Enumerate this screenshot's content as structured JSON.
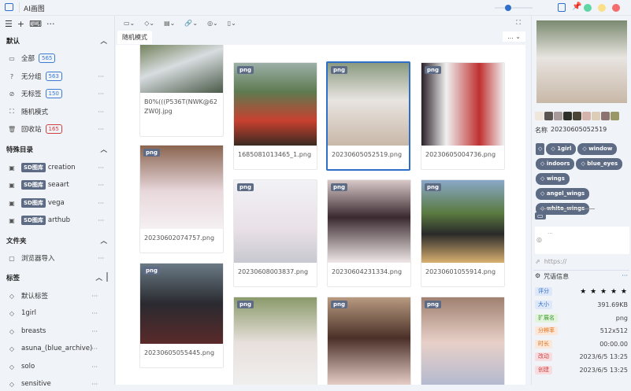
{
  "app": {
    "title": "AI画图",
    "zoom_slider": 0.1,
    "colors": {
      "accent": "#2d6fc9",
      "green": "#5fd6a4",
      "yellow": "#fbe08a",
      "red": "#f46c6c"
    }
  },
  "sidebar": {
    "sections": [
      {
        "title": "默认",
        "items": [
          {
            "icon": "drive-icon",
            "label": "全部",
            "count": "565"
          },
          {
            "icon": "question-icon",
            "label": "无分组",
            "count": "563"
          },
          {
            "icon": "tag-off-icon",
            "label": "无标签",
            "count": "150"
          },
          {
            "icon": "shuffle-icon",
            "label": "随机模式"
          },
          {
            "icon": "trash-icon",
            "label": "回收站",
            "count": "165"
          }
        ]
      },
      {
        "title": "特殊目录",
        "badge": "SD图库",
        "items": [
          {
            "label": "creation"
          },
          {
            "label": "seaart"
          },
          {
            "label": "vega"
          },
          {
            "label": "arthub"
          }
        ]
      },
      {
        "title": "文件夹",
        "items": [
          {
            "label": "浏览器导入"
          }
        ]
      },
      {
        "title": "标签",
        "items": [
          {
            "label": "默认标签"
          },
          {
            "label": "1girl"
          },
          {
            "label": "breasts"
          },
          {
            "label": "asuna_(blue_archive)"
          },
          {
            "label": "solo"
          },
          {
            "label": "sensitive"
          }
        ]
      }
    ],
    "more": "···"
  },
  "main": {
    "tab": "随机模式",
    "more": "... ⌄",
    "cards": [
      {
        "caption": "B0%(((P536T(NWK@62ZW0J.jpg",
        "type": ""
      },
      {
        "caption": "20230602074757.png",
        "type": "png"
      },
      {
        "caption": "20230605055445.png",
        "type": "png"
      },
      {
        "caption": "1685081013465_1.png",
        "type": "png"
      },
      {
        "caption": "20230608003837.png",
        "type": "png"
      },
      {
        "caption": "",
        "type": "png"
      },
      {
        "caption": "20230605052519.png",
        "type": "png"
      },
      {
        "caption": "20230604231334.png",
        "type": "png"
      },
      {
        "caption": "",
        "type": "png"
      },
      {
        "caption": "20230605004736.png",
        "type": "png"
      },
      {
        "caption": "20230601055914.png",
        "type": "png"
      },
      {
        "caption": "",
        "type": "png"
      }
    ]
  },
  "details": {
    "palette": [
      "#efe6dc",
      "#5b5550",
      "#a89a98",
      "#2e3128",
      "#4a4535",
      "#d4b4aa",
      "#dcccb8",
      "#8e7470",
      "#9a9866"
    ],
    "name_label": "名称",
    "name": "20230605052519",
    "tags": [
      "1girl",
      "window",
      "indoors",
      "blue_eyes",
      "wings",
      "angel_wings",
      "white_wings"
    ],
    "note_placeholder": "...",
    "url_placeholder": "https://",
    "info_title": "咒语信息",
    "info_more": "···",
    "rating": 5,
    "stars": "★ ★ ★ ★ ★",
    "info": [
      {
        "k": "评分",
        "v": ""
      },
      {
        "k": "大小",
        "v": "391.69KB"
      },
      {
        "k": "扩展名",
        "v": "png"
      },
      {
        "k": "分辨率",
        "v": "512x512"
      },
      {
        "k": "时长",
        "v": "00:00.00"
      },
      {
        "k": "改动",
        "v": "2023/6/5 13:25"
      },
      {
        "k": "创建",
        "v": "2023/6/5 13:25"
      }
    ]
  }
}
